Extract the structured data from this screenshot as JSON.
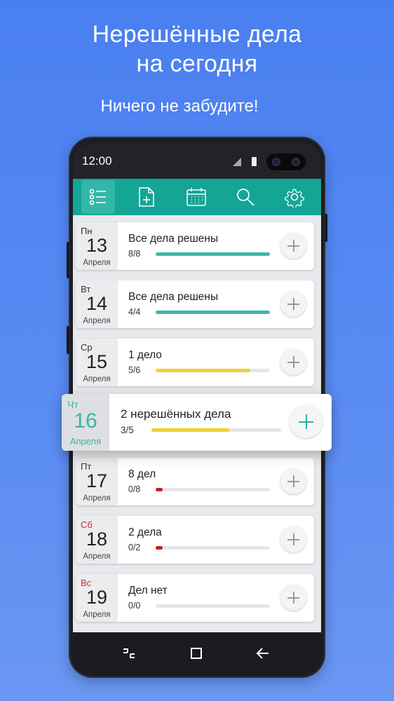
{
  "headline": {
    "line1": "Нерешённые дела",
    "line2": "на сегодня"
  },
  "tagline": "Ничего не забудите!",
  "status_bar": {
    "time": "12:00"
  },
  "toolbar": {
    "icons": [
      "checklist-icon",
      "add-note-icon",
      "calendar-icon",
      "search-icon",
      "gear-icon"
    ]
  },
  "colors": {
    "accent": "#14a596",
    "highlight_date": "#3bb3a4",
    "progress_complete": "#3fb8a8",
    "progress_partial": "#f0cf2e",
    "progress_low": "#c4201e",
    "weekend": "#cc2b2b"
  },
  "days": [
    {
      "dow": "Пн",
      "day": "13",
      "month": "Апреля",
      "title": "Все дела решены",
      "count": "8/8",
      "progress": 1.0,
      "color": "#3fb8a8",
      "weekend": false
    },
    {
      "dow": "Вт",
      "day": "14",
      "month": "Апреля",
      "title": "Все дела решены",
      "count": "4/4",
      "progress": 1.0,
      "color": "#3fb8a8",
      "weekend": false
    },
    {
      "dow": "Ср",
      "day": "15",
      "month": "Апреля",
      "title": "1 дело",
      "count": "5/6",
      "progress": 0.83,
      "color": "#f0cf2e",
      "weekend": false
    },
    {
      "dow": "Пт",
      "day": "17",
      "month": "Апреля",
      "title": "8 дел",
      "count": "0/8",
      "progress": 0.06,
      "color": "#c4201e",
      "weekend": false
    },
    {
      "dow": "Сб",
      "day": "18",
      "month": "Апреля",
      "title": "2 дела",
      "count": "0/2",
      "progress": 0.06,
      "color": "#c4201e",
      "weekend": true
    },
    {
      "dow": "Вс",
      "day": "19",
      "month": "Апреля",
      "title": "Дел нет",
      "count": "0/0",
      "progress": 0.0,
      "color": "#c4201e",
      "weekend": true
    }
  ],
  "highlight": {
    "dow": "Чт",
    "day": "16",
    "month": "Апреля",
    "title": "2 нерешённых дела",
    "count": "3/5",
    "progress": 0.6,
    "color": "#f0cf2e"
  },
  "navbar": {
    "icons": [
      "recent-apps-icon",
      "home-icon",
      "back-icon"
    ]
  }
}
